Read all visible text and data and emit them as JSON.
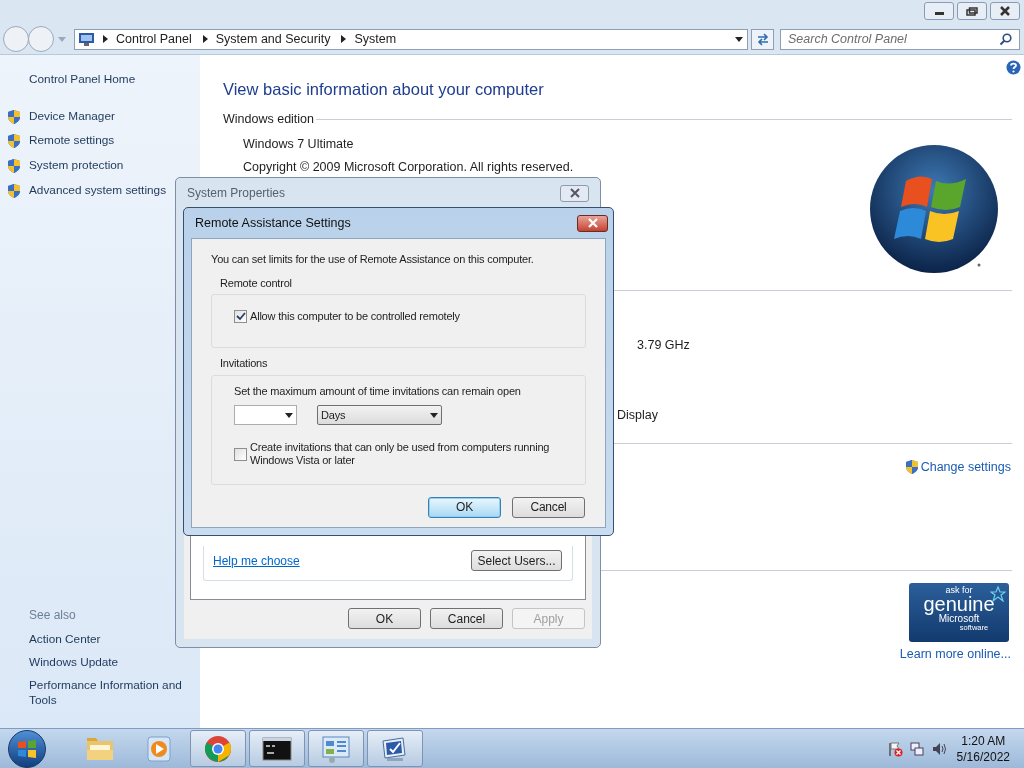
{
  "address_bar": {
    "breadcrumbs": [
      "Control Panel",
      "System and Security",
      "System"
    ]
  },
  "search": {
    "placeholder": "Search Control Panel"
  },
  "sidebar": {
    "home": "Control Panel Home",
    "tasks": [
      "Device Manager",
      "Remote settings",
      "System protection",
      "Advanced system settings"
    ],
    "see_also_title": "See also",
    "see_also": [
      "Action Center",
      "Windows Update",
      "Performance Information and Tools"
    ]
  },
  "main": {
    "heading": "View basic information about your computer",
    "section": "Windows edition",
    "edition": "Windows 7 Ultimate",
    "copyright": "Copyright © 2009 Microsoft Corporation.  All rights reserved.",
    "processor_speed": "3.79 GHz",
    "display_fragment": "Display",
    "change_settings": "Change settings",
    "genuine": [
      "ask for",
      "genuine",
      "Microsoft",
      "software"
    ],
    "learn_more": "Learn more online..."
  },
  "system_properties": {
    "title": "System Properties",
    "help_link": "Help me choose",
    "select_users": "Select Users...",
    "buttons": [
      {
        "label": "OK",
        "disabled": false
      },
      {
        "label": "Cancel",
        "disabled": false
      },
      {
        "label": "Apply",
        "disabled": true
      }
    ]
  },
  "remote_assistance": {
    "title": "Remote Assistance Settings",
    "intro": "You can set limits for the use of Remote Assistance on this computer.",
    "remote_control": {
      "legend": "Remote control",
      "checkbox": {
        "label": "Allow this computer to be controlled remotely",
        "checked": true
      }
    },
    "invitations": {
      "legend": "Invitations",
      "prompt": "Set the maximum amount of time invitations can remain open",
      "unit": "Days",
      "checkbox": {
        "label": "Create invitations that can only be used from computers running Windows Vista or later",
        "checked": false
      }
    },
    "buttons": [
      {
        "label": "OK",
        "default": true
      },
      {
        "label": "Cancel",
        "default": false
      }
    ]
  },
  "taskbar": {
    "items": [
      {
        "kind": "folder",
        "running": false
      },
      {
        "kind": "media",
        "running": false
      },
      {
        "kind": "browser",
        "running": true
      },
      {
        "kind": "terminal",
        "running": true
      },
      {
        "kind": "panel",
        "running": true
      },
      {
        "kind": "system",
        "running": true
      }
    ],
    "time": "1:20 AM",
    "date": "5/16/2022"
  }
}
